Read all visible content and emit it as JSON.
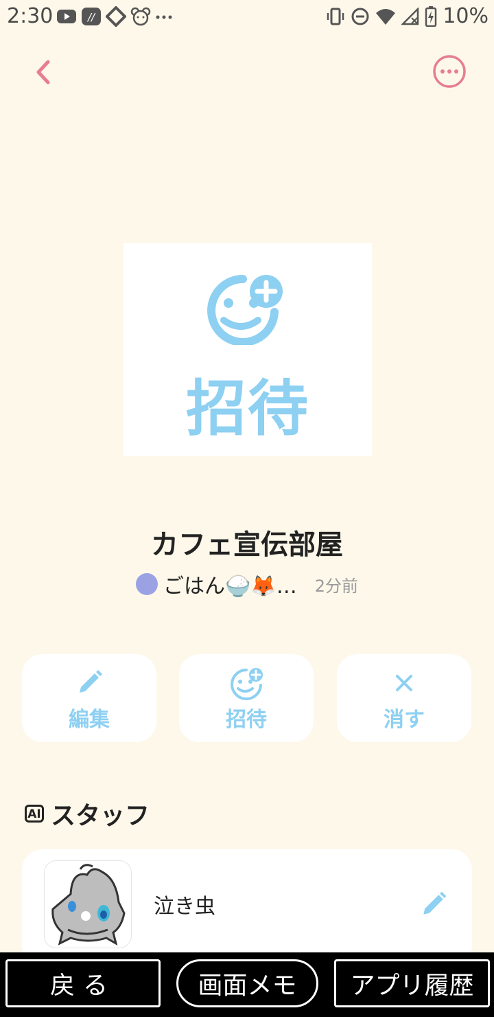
{
  "status_bar": {
    "time": "2:30",
    "left_icons": [
      "youtube-icon",
      "app-icon",
      "diamond-icon",
      "bear-icon",
      "more-dots-icon"
    ],
    "right_icons": [
      "vibrate-icon",
      "dnd-icon",
      "wifi-icon",
      "no-signal-icon",
      "battery-charging-icon"
    ],
    "battery": "10%"
  },
  "header": {
    "back_icon": "chevron-left-icon",
    "more_icon": "more-horizontal-icon",
    "accent_color": "#e67e8f"
  },
  "invite_image": {
    "text": "招待",
    "icon": "smile-plus-icon",
    "color": "#8dd0f2"
  },
  "room": {
    "title": "カフェ宣伝部屋",
    "last_sender": "ごはん🍚🦊…",
    "time_ago": "2分前"
  },
  "actions": [
    {
      "label": "編集",
      "icon": "pencil-icon"
    },
    {
      "label": "招待",
      "icon": "smile-plus-icon"
    },
    {
      "label": "消す",
      "icon": "close-icon"
    }
  ],
  "staff_section": {
    "badge": "AI",
    "title": "スタッフ",
    "members": [
      {
        "name": "泣き虫",
        "edit_icon": "pencil-icon"
      }
    ]
  },
  "bottom_bar": {
    "back": "戻る",
    "memo": "画面メモ",
    "history": "アプリ履歴"
  }
}
